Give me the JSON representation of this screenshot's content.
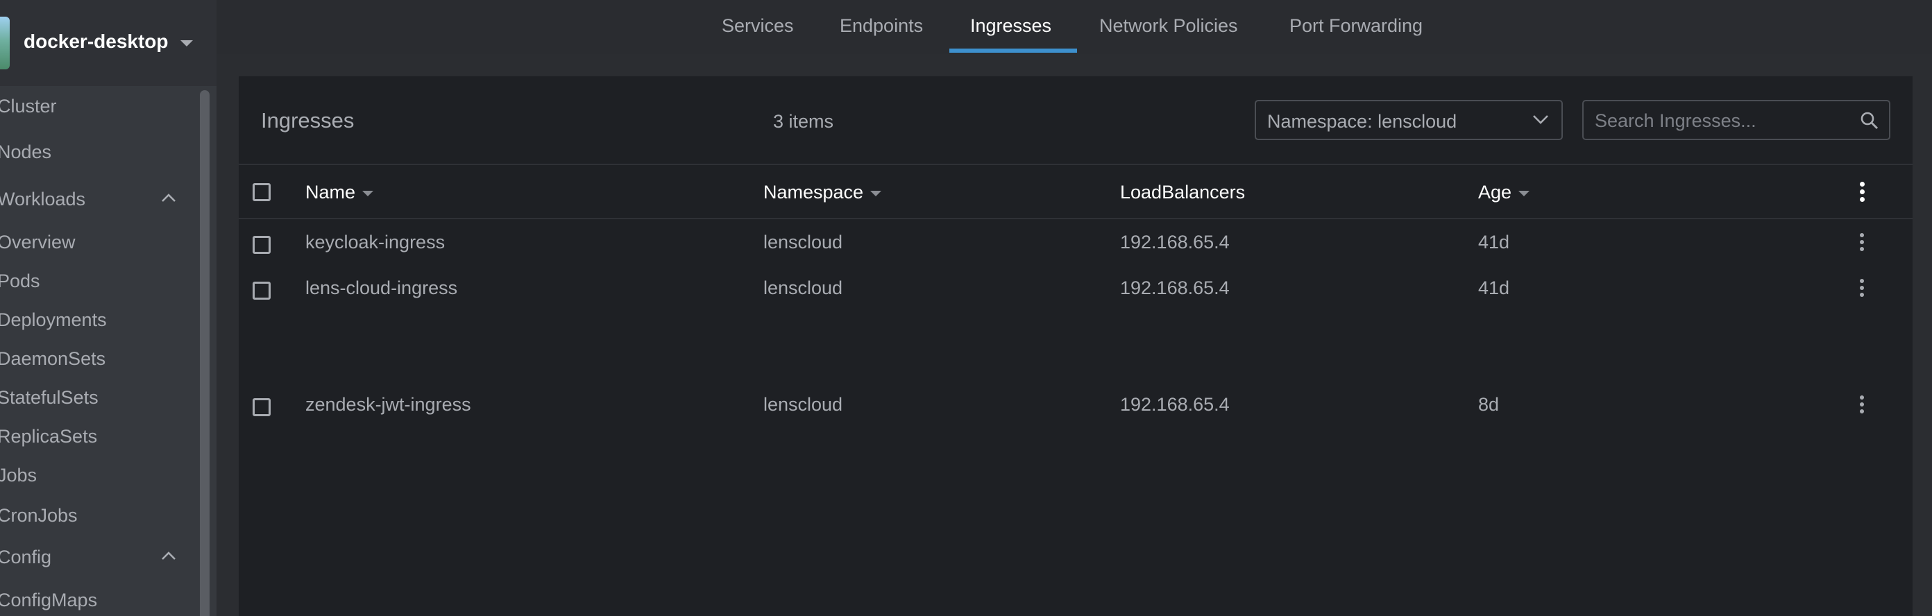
{
  "cluster": {
    "name": "docker-desktop"
  },
  "sidebar": {
    "items": [
      {
        "label": "Cluster"
      },
      {
        "label": "Nodes"
      },
      {
        "label": "Workloads"
      },
      {
        "label": "Overview"
      },
      {
        "label": "Pods"
      },
      {
        "label": "Deployments"
      },
      {
        "label": "DaemonSets"
      },
      {
        "label": "StatefulSets"
      },
      {
        "label": "ReplicaSets"
      },
      {
        "label": "Jobs"
      },
      {
        "label": "CronJobs"
      },
      {
        "label": "Config"
      },
      {
        "label": "ConfigMaps"
      }
    ]
  },
  "tabs": [
    {
      "label": "Services"
    },
    {
      "label": "Endpoints"
    },
    {
      "label": "Ingresses"
    },
    {
      "label": "Network Policies"
    },
    {
      "label": "Port Forwarding"
    }
  ],
  "panel": {
    "title": "Ingresses",
    "count": "3 items",
    "namespace_select": "Namespace: lenscloud",
    "search_placeholder": "Search Ingresses..."
  },
  "table": {
    "columns": [
      {
        "label": "Name"
      },
      {
        "label": "Namespace"
      },
      {
        "label": "LoadBalancers"
      },
      {
        "label": "Age"
      }
    ],
    "rows": [
      {
        "name": "keycloak-ingress",
        "namespace": "lenscloud",
        "loadbalancers": "192.168.65.4",
        "age": "41d"
      },
      {
        "name": "lens-cloud-ingress",
        "namespace": "lenscloud",
        "loadbalancers": "192.168.65.4",
        "age": "41d"
      },
      {
        "name": "zendesk-jwt-ingress",
        "namespace": "lenscloud",
        "loadbalancers": "192.168.65.4",
        "age": "8d"
      }
    ]
  },
  "colors": {
    "accent": "#3d90ce",
    "panel_bg": "#1e2024",
    "sidebar_bg": "#36393e"
  }
}
